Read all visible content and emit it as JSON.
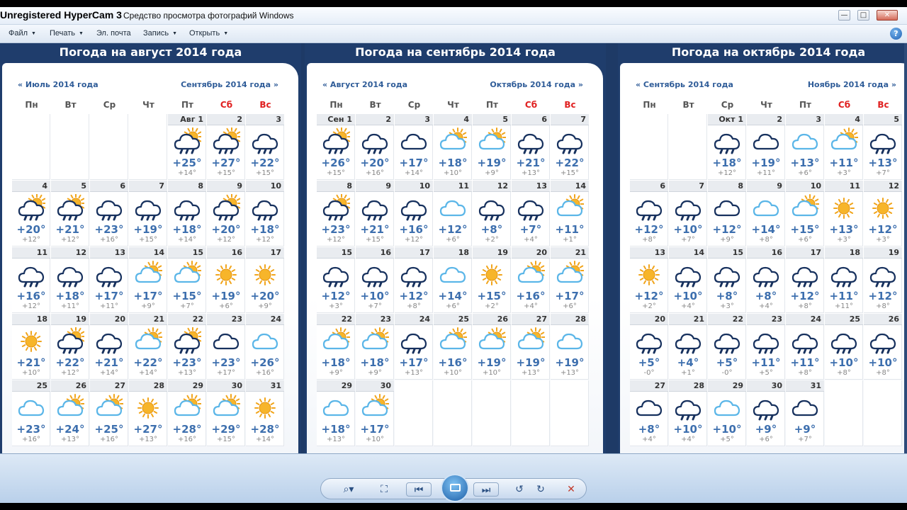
{
  "window": {
    "hypercam": "Unregistered HyperCam 3",
    "title": "Средство просмотра фотографий Windows",
    "controls": {
      "minimize": "—",
      "maximize": "□",
      "close": "✕"
    }
  },
  "menu": [
    {
      "label": "Файл"
    },
    {
      "label": "Печать"
    },
    {
      "label": "Эл. почта"
    },
    {
      "label": "Запись"
    },
    {
      "label": "Открыть"
    }
  ],
  "help": "?",
  "weekdays": [
    "Пн",
    "Вт",
    "Ср",
    "Чт",
    "Пт",
    "Сб",
    "Вс"
  ],
  "months": [
    {
      "title": "Погода на август 2014 года",
      "prev": "« Июль 2014 года",
      "next": "Сентябрь 2014 года »",
      "offset": 4,
      "days": [
        {
          "d": "Авг 1",
          "icon": "cloud-rain-sun",
          "hi": "+25°",
          "lo": "+14°"
        },
        {
          "d": "2",
          "icon": "cloud-rain-sun",
          "hi": "+27°",
          "lo": "+15°"
        },
        {
          "d": "3",
          "icon": "cloud-rain",
          "hi": "+22°",
          "lo": "+15°"
        },
        {
          "d": "4",
          "icon": "cloud-rain-sun",
          "hi": "+20°",
          "lo": "+12°"
        },
        {
          "d": "5",
          "icon": "cloud-rain-sun",
          "hi": "+21°",
          "lo": "+12°"
        },
        {
          "d": "6",
          "icon": "cloud-rain",
          "hi": "+23°",
          "lo": "+16°"
        },
        {
          "d": "7",
          "icon": "cloud-rain",
          "hi": "+19°",
          "lo": "+15°"
        },
        {
          "d": "8",
          "icon": "cloud-rain",
          "hi": "+18°",
          "lo": "+14°"
        },
        {
          "d": "9",
          "icon": "cloud-rain-sun",
          "hi": "+20°",
          "lo": "+12°"
        },
        {
          "d": "10",
          "icon": "cloud-rain",
          "hi": "+18°",
          "lo": "+12°"
        },
        {
          "d": "11",
          "icon": "cloud-rain",
          "hi": "+16°",
          "lo": "+12°"
        },
        {
          "d": "12",
          "icon": "cloud-rain",
          "hi": "+18°",
          "lo": "+11°"
        },
        {
          "d": "13",
          "icon": "cloud-rain",
          "hi": "+17°",
          "lo": "+11°"
        },
        {
          "d": "14",
          "icon": "cloud-sun",
          "hi": "+17°",
          "lo": "+9°"
        },
        {
          "d": "15",
          "icon": "cloud-sun",
          "hi": "+15°",
          "lo": "+7°"
        },
        {
          "d": "16",
          "icon": "sun",
          "hi": "+19°",
          "lo": "+6°"
        },
        {
          "d": "17",
          "icon": "sun",
          "hi": "+20°",
          "lo": "+9°"
        },
        {
          "d": "18",
          "icon": "sun",
          "hi": "+21°",
          "lo": "+10°"
        },
        {
          "d": "19",
          "icon": "cloud-rain-sun",
          "hi": "+22°",
          "lo": "+12°"
        },
        {
          "d": "20",
          "icon": "cloud-rain",
          "hi": "+21°",
          "lo": "+14°"
        },
        {
          "d": "21",
          "icon": "cloud-sun",
          "hi": "+22°",
          "lo": "+14°"
        },
        {
          "d": "22",
          "icon": "cloud-rain-sun",
          "hi": "+23°",
          "lo": "+13°"
        },
        {
          "d": "23",
          "icon": "cloud-dark",
          "hi": "+23°",
          "lo": "+17°"
        },
        {
          "d": "24",
          "icon": "cloud",
          "hi": "+26°",
          "lo": "+16°"
        },
        {
          "d": "25",
          "icon": "cloud",
          "hi": "+23°",
          "lo": "+16°"
        },
        {
          "d": "26",
          "icon": "cloud-sun",
          "hi": "+24°",
          "lo": "+13°"
        },
        {
          "d": "27",
          "icon": "cloud-sun",
          "hi": "+25°",
          "lo": "+16°"
        },
        {
          "d": "28",
          "icon": "sun",
          "hi": "+27°",
          "lo": "+13°"
        },
        {
          "d": "29",
          "icon": "cloud-sun",
          "hi": "+28°",
          "lo": "+16°"
        },
        {
          "d": "30",
          "icon": "cloud-sun",
          "hi": "+29°",
          "lo": "+15°"
        },
        {
          "d": "31",
          "icon": "sun",
          "hi": "+28°",
          "lo": "+14°"
        }
      ]
    },
    {
      "title": "Погода на сентябрь 2014 года",
      "prev": "« Август 2014 года",
      "next": "Октябрь 2014 года »",
      "offset": 0,
      "days": [
        {
          "d": "Сен 1",
          "icon": "cloud-rain-sun",
          "hi": "+26°",
          "lo": "+15°"
        },
        {
          "d": "2",
          "icon": "cloud-rain",
          "hi": "+20°",
          "lo": "+16°"
        },
        {
          "d": "3",
          "icon": "cloud-dark",
          "hi": "+17°",
          "lo": "+14°"
        },
        {
          "d": "4",
          "icon": "cloud-sun",
          "hi": "+18°",
          "lo": "+10°"
        },
        {
          "d": "5",
          "icon": "cloud-sun",
          "hi": "+19°",
          "lo": "+9°"
        },
        {
          "d": "6",
          "icon": "cloud-rain",
          "hi": "+21°",
          "lo": "+13°"
        },
        {
          "d": "7",
          "icon": "cloud-rain",
          "hi": "+22°",
          "lo": "+15°"
        },
        {
          "d": "8",
          "icon": "cloud-rain-sun",
          "hi": "+23°",
          "lo": "+12°"
        },
        {
          "d": "9",
          "icon": "cloud-rain",
          "hi": "+21°",
          "lo": "+15°"
        },
        {
          "d": "10",
          "icon": "cloud-rain",
          "hi": "+16°",
          "lo": "+12°"
        },
        {
          "d": "11",
          "icon": "cloud",
          "hi": "+12°",
          "lo": "+6°"
        },
        {
          "d": "12",
          "icon": "cloud-rain",
          "hi": "+8°",
          "lo": "+2°"
        },
        {
          "d": "13",
          "icon": "cloud-rain",
          "hi": "+7°",
          "lo": "+4°"
        },
        {
          "d": "14",
          "icon": "cloud-sun",
          "hi": "+11°",
          "lo": "+1°"
        },
        {
          "d": "15",
          "icon": "cloud-rain",
          "hi": "+12°",
          "lo": "+3°"
        },
        {
          "d": "16",
          "icon": "cloud-rain",
          "hi": "+10°",
          "lo": "+7°"
        },
        {
          "d": "17",
          "icon": "cloud-rain",
          "hi": "+12°",
          "lo": "+8°"
        },
        {
          "d": "18",
          "icon": "cloud",
          "hi": "+14°",
          "lo": "+6°"
        },
        {
          "d": "19",
          "icon": "sun",
          "hi": "+15°",
          "lo": "+2°"
        },
        {
          "d": "20",
          "icon": "cloud-sun",
          "hi": "+16°",
          "lo": "+4°"
        },
        {
          "d": "21",
          "icon": "cloud-sun",
          "hi": "+17°",
          "lo": "+6°"
        },
        {
          "d": "22",
          "icon": "cloud-sun",
          "hi": "+18°",
          "lo": "+9°"
        },
        {
          "d": "23",
          "icon": "cloud-sun",
          "hi": "+18°",
          "lo": "+9°"
        },
        {
          "d": "24",
          "icon": "cloud-rain",
          "hi": "+17°",
          "lo": "+13°"
        },
        {
          "d": "25",
          "icon": "cloud-sun",
          "hi": "+16°",
          "lo": "+10°"
        },
        {
          "d": "26",
          "icon": "cloud-sun",
          "hi": "+19°",
          "lo": "+10°"
        },
        {
          "d": "27",
          "icon": "cloud-sun",
          "hi": "+19°",
          "lo": "+13°"
        },
        {
          "d": "28",
          "icon": "cloud",
          "hi": "+19°",
          "lo": "+13°"
        },
        {
          "d": "29",
          "icon": "cloud",
          "hi": "+18°",
          "lo": "+13°"
        },
        {
          "d": "30",
          "icon": "cloud-sun",
          "hi": "+17°",
          "lo": "+10°"
        }
      ]
    },
    {
      "title": "Погода на октябрь 2014 года",
      "prev": "« Сентябрь 2014 года",
      "next": "Ноябрь 2014 года »",
      "offset": 2,
      "days": [
        {
          "d": "Окт 1",
          "icon": "cloud-rain",
          "hi": "+18°",
          "lo": "+12°"
        },
        {
          "d": "2",
          "icon": "cloud-dark",
          "hi": "+19°",
          "lo": "+11°"
        },
        {
          "d": "3",
          "icon": "cloud",
          "hi": "+13°",
          "lo": "+6°"
        },
        {
          "d": "4",
          "icon": "cloud-sun",
          "hi": "+11°",
          "lo": "+3°"
        },
        {
          "d": "5",
          "icon": "cloud-rain",
          "hi": "+13°",
          "lo": "+7°"
        },
        {
          "d": "6",
          "icon": "cloud-rain",
          "hi": "+12°",
          "lo": "+8°"
        },
        {
          "d": "7",
          "icon": "cloud-rain",
          "hi": "+10°",
          "lo": "+7°"
        },
        {
          "d": "8",
          "icon": "cloud-dark",
          "hi": "+12°",
          "lo": "+9°"
        },
        {
          "d": "9",
          "icon": "cloud",
          "hi": "+14°",
          "lo": "+8°"
        },
        {
          "d": "10",
          "icon": "cloud-sun",
          "hi": "+15°",
          "lo": "+6°"
        },
        {
          "d": "11",
          "icon": "sun",
          "hi": "+13°",
          "lo": "+3°"
        },
        {
          "d": "12",
          "icon": "sun",
          "hi": "+12°",
          "lo": "+3°"
        },
        {
          "d": "13",
          "icon": "sun",
          "hi": "+12°",
          "lo": "+2°"
        },
        {
          "d": "14",
          "icon": "cloud-rain",
          "hi": "+10°",
          "lo": "+4°"
        },
        {
          "d": "15",
          "icon": "cloud-rain",
          "hi": "+8°",
          "lo": "+3°"
        },
        {
          "d": "16",
          "icon": "cloud-rain",
          "hi": "+8°",
          "lo": "+4°"
        },
        {
          "d": "17",
          "icon": "cloud-rain",
          "hi": "+12°",
          "lo": "+8°"
        },
        {
          "d": "18",
          "icon": "cloud-rain",
          "hi": "+11°",
          "lo": "+11°"
        },
        {
          "d": "19",
          "icon": "cloud-rain",
          "hi": "+12°",
          "lo": "+8°"
        },
        {
          "d": "20",
          "icon": "cloud-rain",
          "hi": "+5°",
          "lo": "-0°"
        },
        {
          "d": "21",
          "icon": "cloud-rain",
          "hi": "+4°",
          "lo": "+1°"
        },
        {
          "d": "22",
          "icon": "cloud-rain",
          "hi": "+5°",
          "lo": "-0°"
        },
        {
          "d": "23",
          "icon": "cloud-rain",
          "hi": "+11°",
          "lo": "+5°"
        },
        {
          "d": "24",
          "icon": "cloud-rain",
          "hi": "+11°",
          "lo": "+8°"
        },
        {
          "d": "25",
          "icon": "cloud-rain",
          "hi": "+10°",
          "lo": "+8°"
        },
        {
          "d": "26",
          "icon": "cloud-rain",
          "hi": "+10°",
          "lo": "+8°"
        },
        {
          "d": "27",
          "icon": "cloud-dark",
          "hi": "+8°",
          "lo": "+4°"
        },
        {
          "d": "28",
          "icon": "cloud-rain",
          "hi": "+10°",
          "lo": "+4°"
        },
        {
          "d": "29",
          "icon": "cloud",
          "hi": "+10°",
          "lo": "+5°"
        },
        {
          "d": "30",
          "icon": "cloud-rain",
          "hi": "+9°",
          "lo": "+6°"
        },
        {
          "d": "31",
          "icon": "cloud-dark",
          "hi": "+9°",
          "lo": "+7°"
        }
      ]
    }
  ],
  "toolbar": {
    "zoom": "⌕▾",
    "fit": "⛶",
    "prev": "⏮",
    "next": "⏭",
    "rotate_left": "↺",
    "rotate_right": "↻",
    "delete": "✕"
  },
  "colors": {
    "accent": "#3d6fae",
    "weekend": "#e02020",
    "header_bg": "#1f3d6c"
  }
}
